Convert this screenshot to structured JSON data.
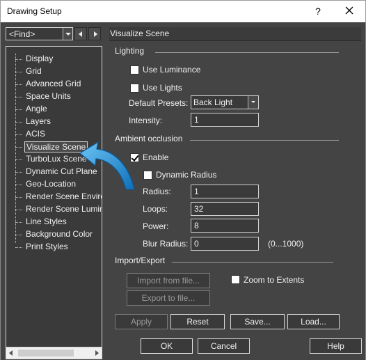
{
  "window": {
    "title": "Drawing Setup",
    "help_glyph": "?"
  },
  "left": {
    "find_value": "<Find>",
    "tree_items": [
      "Display",
      "Grid",
      "Advanced Grid",
      "Space Units",
      "Angle",
      "Layers",
      "ACIS",
      "Visualize Scene",
      "TurboLux Scene",
      "Dynamic Cut Plane",
      "Geo-Location",
      "Render Scene Environment",
      "Render Scene Luminance",
      "Line Styles",
      "Background Color",
      "Print Styles"
    ],
    "selected_index": 7
  },
  "panel": {
    "title": "Visualize Scene",
    "lighting": {
      "label": "Lighting",
      "use_luminance": {
        "label": "Use Luminance",
        "checked": false
      },
      "use_lights": {
        "label": "Use Lights",
        "checked": false
      },
      "default_presets_label": "Default Presets:",
      "default_presets_value": "Back Light",
      "intensity_label": "Intensity:",
      "intensity_value": "1"
    },
    "ambient": {
      "label": "Ambient occlusion",
      "enable": {
        "label": "Enable",
        "checked": true
      },
      "dynamic_radius": {
        "label": "Dynamic Radius",
        "checked": false
      },
      "radius_label": "Radius:",
      "radius_value": "1",
      "loops_label": "Loops:",
      "loops_value": "32",
      "power_label": "Power:",
      "power_value": "8",
      "blur_label": "Blur Radius:",
      "blur_value": "0",
      "blur_hint": "(0...1000)"
    },
    "import_export": {
      "label": "Import/Export",
      "import_button": "Import from file...",
      "export_button": "Export to file...",
      "zoom_extents": {
        "label": "Zoom to Extents",
        "checked": false
      }
    },
    "actions": {
      "apply": "Apply",
      "reset": "Reset",
      "save": "Save...",
      "load": "Load..."
    }
  },
  "footer": {
    "ok": "OK",
    "cancel": "Cancel",
    "help": "Help"
  },
  "colors": {
    "background": "#444444",
    "annotation_arrow": "#1f8fd6"
  },
  "icons": [
    "close-icon",
    "chevron-down-icon",
    "chevron-left-icon",
    "chevron-right-icon",
    "check-icon",
    "pointer-arrow-icon"
  ]
}
